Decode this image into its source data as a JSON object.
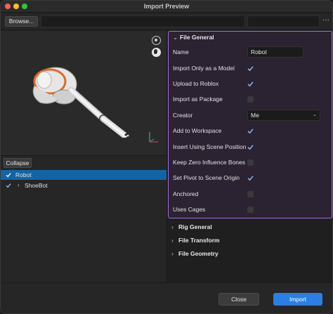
{
  "window": {
    "title": "Import Preview"
  },
  "toolbar": {
    "browse_label": "Browse...",
    "more_icon": "ellipsis-icon",
    "more_glyph": "···"
  },
  "viewport": {
    "icons": [
      "rotate-view-icon",
      "globe-icon",
      "axes-gizmo-icon"
    ]
  },
  "hierarchy": {
    "collapse_label": "Collapse",
    "items": [
      {
        "label": "Robot",
        "checked": true,
        "selected": true
      },
      {
        "label": "ShoeBot",
        "checked": true,
        "selected": false,
        "chevron": "›"
      }
    ]
  },
  "file_general": {
    "header": "File General",
    "arrow": "⌄",
    "name_label": "Name",
    "name_value": "Robot",
    "props": [
      {
        "label": "Import Only as a Model",
        "checked": true
      },
      {
        "label": "Upload to Roblox",
        "checked": true
      },
      {
        "label": "Import as Package",
        "checked": false
      }
    ],
    "creator_label": "Creator",
    "creator_value": "Me",
    "creator_dd": "⌄",
    "props2": [
      {
        "label": "Add to Workspace",
        "checked": true
      },
      {
        "label": "Insert Using Scene Position",
        "checked": true
      },
      {
        "label": "Keep Zero Influence Bones",
        "checked": false
      },
      {
        "label": "Set Pivot to Scene Origin",
        "checked": true
      },
      {
        "label": "Anchored",
        "checked": false
      },
      {
        "label": "Uses Cages",
        "checked": false
      }
    ]
  },
  "sections": [
    {
      "label": "Rig General",
      "arrow": "›"
    },
    {
      "label": "File Transform",
      "arrow": "›"
    },
    {
      "label": "File Geometry",
      "arrow": "›"
    }
  ],
  "footer": {
    "close_label": "Close",
    "import_label": "Import"
  },
  "colors": {
    "accent": "#2b7fe4",
    "highlight_border": "#a66de6",
    "selection": "#1464a5"
  }
}
